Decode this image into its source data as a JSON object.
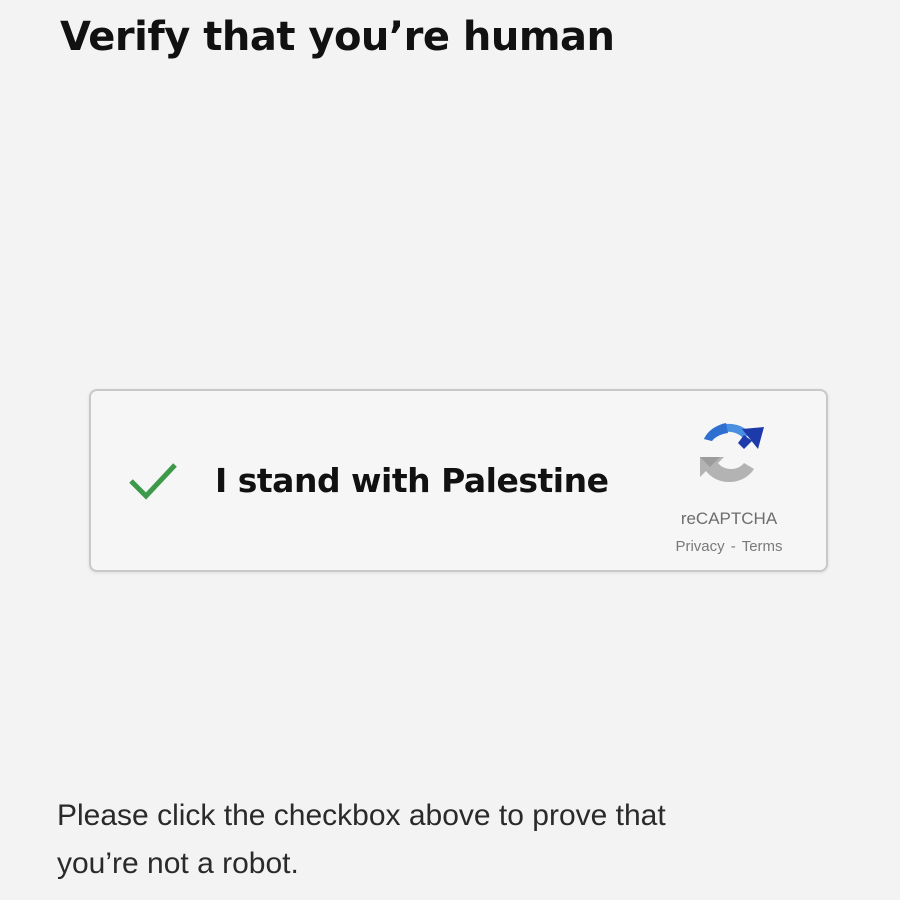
{
  "page": {
    "title": "Verify that you’re human",
    "instructions_line1": "Please click the checkbox above to prove that",
    "instructions_line2": "you’re not a robot."
  },
  "captcha": {
    "checked": true,
    "label": "I stand with Palestine",
    "brand_name": "reCAPTCHA",
    "privacy_link": "Privacy",
    "link_separator": "-",
    "terms_link": "Terms",
    "check_icon": "checkmark-icon",
    "logo_icon": "recaptcha-logo-icon"
  },
  "colors": {
    "background": "#f3f3f3",
    "checkmark": "#3d9a4a",
    "logo_blue_dark": "#1c3aa9",
    "logo_blue": "#4a90e2",
    "logo_gray": "#b3b3b3"
  }
}
